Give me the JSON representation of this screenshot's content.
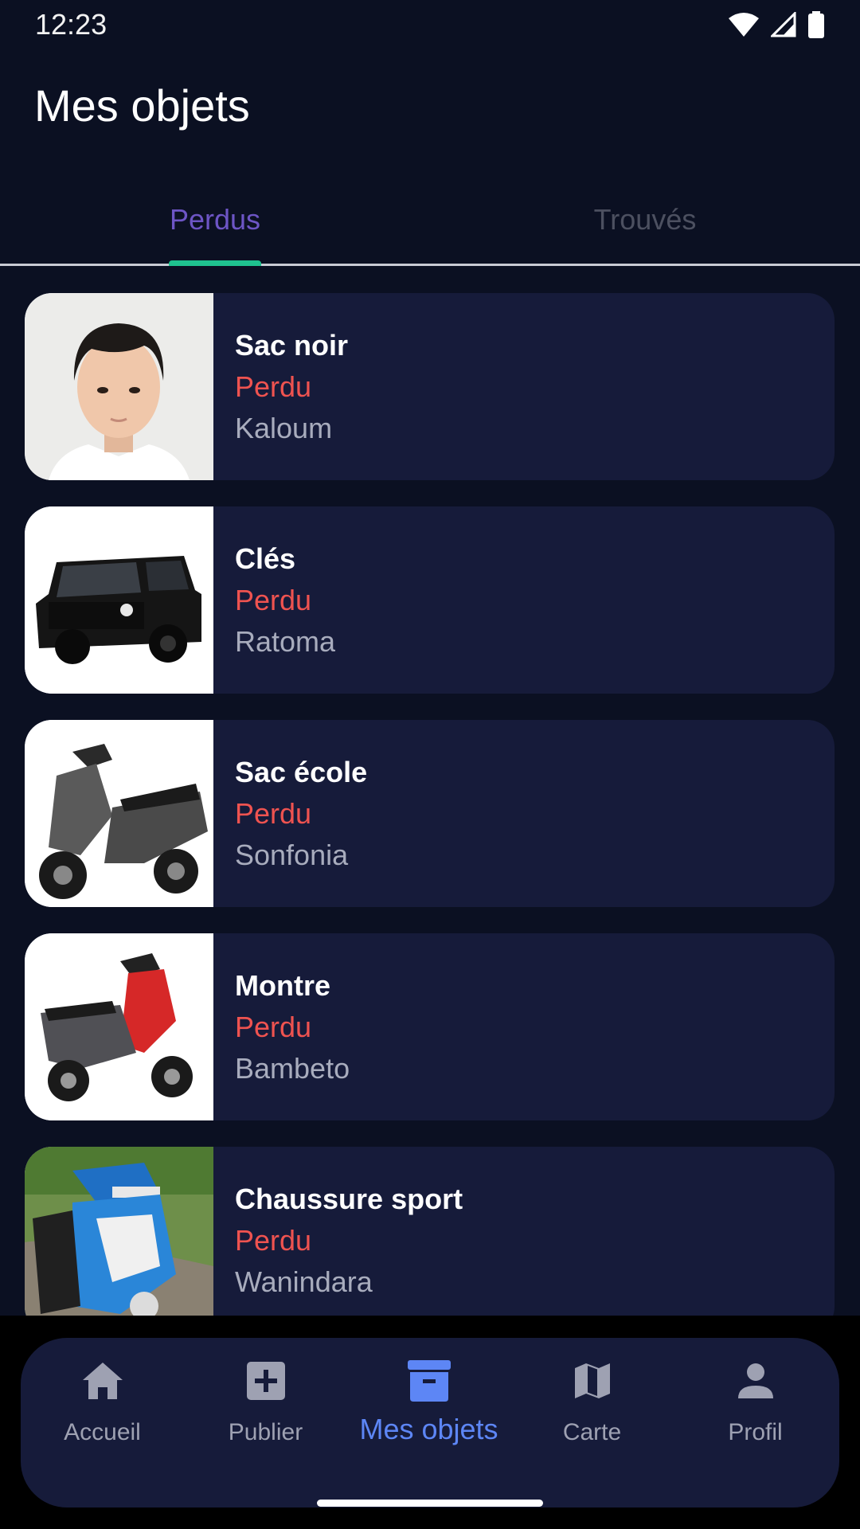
{
  "status_bar": {
    "time": "12:23"
  },
  "header": {
    "title": "Mes objets"
  },
  "tabs": [
    {
      "label": "Perdus",
      "active": true
    },
    {
      "label": "Trouvés",
      "active": false
    }
  ],
  "items": [
    {
      "title": "Sac noir",
      "status": "Perdu",
      "location": "Kaloum",
      "image": "child-portrait"
    },
    {
      "title": "Clés",
      "status": "Perdu",
      "location": "Ratoma",
      "image": "black-suv"
    },
    {
      "title": "Sac école",
      "status": "Perdu",
      "location": "Sonfonia",
      "image": "grey-scooter"
    },
    {
      "title": "Montre",
      "status": "Perdu",
      "location": "Bambeto",
      "image": "red-scooter"
    },
    {
      "title": "Chaussure sport",
      "status": "Perdu",
      "location": "Wanindara",
      "image": "blue-scooter"
    }
  ],
  "bottom_nav": [
    {
      "label": "Accueil",
      "icon": "home-icon",
      "active": false
    },
    {
      "label": "Publier",
      "icon": "add-box-icon",
      "active": false
    },
    {
      "label": "Mes objets",
      "icon": "archive-icon",
      "active": true
    },
    {
      "label": "Carte",
      "icon": "map-icon",
      "active": false
    },
    {
      "label": "Profil",
      "icon": "person-icon",
      "active": false
    }
  ],
  "colors": {
    "background": "#0b1022",
    "card": "#161b3a",
    "status_lost": "#ef5350",
    "tab_active": "#6d55c5",
    "tab_indicator": "#1fc28f",
    "nav_active": "#5d86f5"
  }
}
